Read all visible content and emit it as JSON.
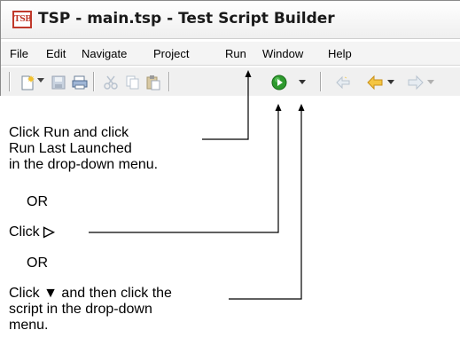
{
  "window": {
    "app_icon_text": "TSB",
    "title": "TSP - main.tsp - Test Script Builder"
  },
  "menu": [
    "File",
    "Edit",
    "Navigate",
    "Project",
    "Run",
    "Window",
    "Help"
  ],
  "toolbar": {
    "icons": [
      "new-icon",
      "save-icon",
      "print-icon",
      "cut-icon",
      "copy-icon",
      "paste-icon",
      "run-icon",
      "run-dropdown-arrow-icon",
      "back-icon",
      "previous-icon",
      "next-icon"
    ]
  },
  "callouts": {
    "first_line1": "Click Run and click",
    "first_line2": "Run Last Launched",
    "first_line3": "in the drop-down menu.",
    "or1": "OR",
    "second": "Click",
    "second_symbol": "▷",
    "or2": "OR",
    "third_line1_pre": "Click",
    "third_line1_symbol": "▼",
    "third_line1_post": "and then click the",
    "third_line2": "script in the drop-down",
    "third_line3": "menu."
  },
  "colors": {
    "run_icon": "#2e9a2e",
    "arrow_icon": "#e8a21b",
    "title_icon": "#c0392b"
  }
}
